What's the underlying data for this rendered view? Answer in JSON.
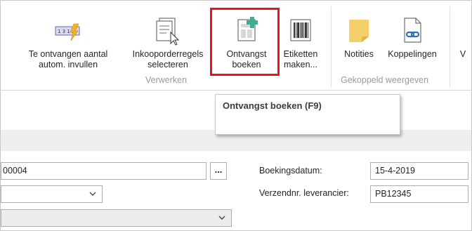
{
  "ribbon": {
    "buttons": [
      {
        "label": "Te ontvangen aantal\nautom. invullen",
        "icon": "auto-fill-quantity-icon"
      },
      {
        "label": "Inkooporderregels\nselecteren",
        "icon": "select-lines-icon"
      },
      {
        "label": "Ontvangst\nboeken",
        "icon": "post-receipt-icon"
      },
      {
        "label": "Etiketten\nmaken...",
        "icon": "barcode-icon"
      },
      {
        "label": "Notities",
        "icon": "notes-icon"
      },
      {
        "label": "Koppelingen",
        "icon": "link-icon"
      },
      {
        "label": "V",
        "icon": ""
      }
    ],
    "groups": {
      "verwerken": "Verwerken",
      "gekoppeld": "Gekoppeld weergeven"
    }
  },
  "tooltip": {
    "title": "Ontvangst boeken (F9)"
  },
  "form": {
    "number_value": "00004",
    "lookup_label": "...",
    "boekingsdatum_label": "Boekingsdatum:",
    "boekingsdatum_value": "15-4-2019",
    "verzendnr_label": "Verzendnr. leverancier:",
    "verzendnr_value": "PB12345"
  },
  "colors": {
    "highlight": "#e8141b",
    "notes_icon": "#f5cf6a",
    "post_plus": "#3dae8f",
    "link_icon": "#2e6fb7"
  }
}
